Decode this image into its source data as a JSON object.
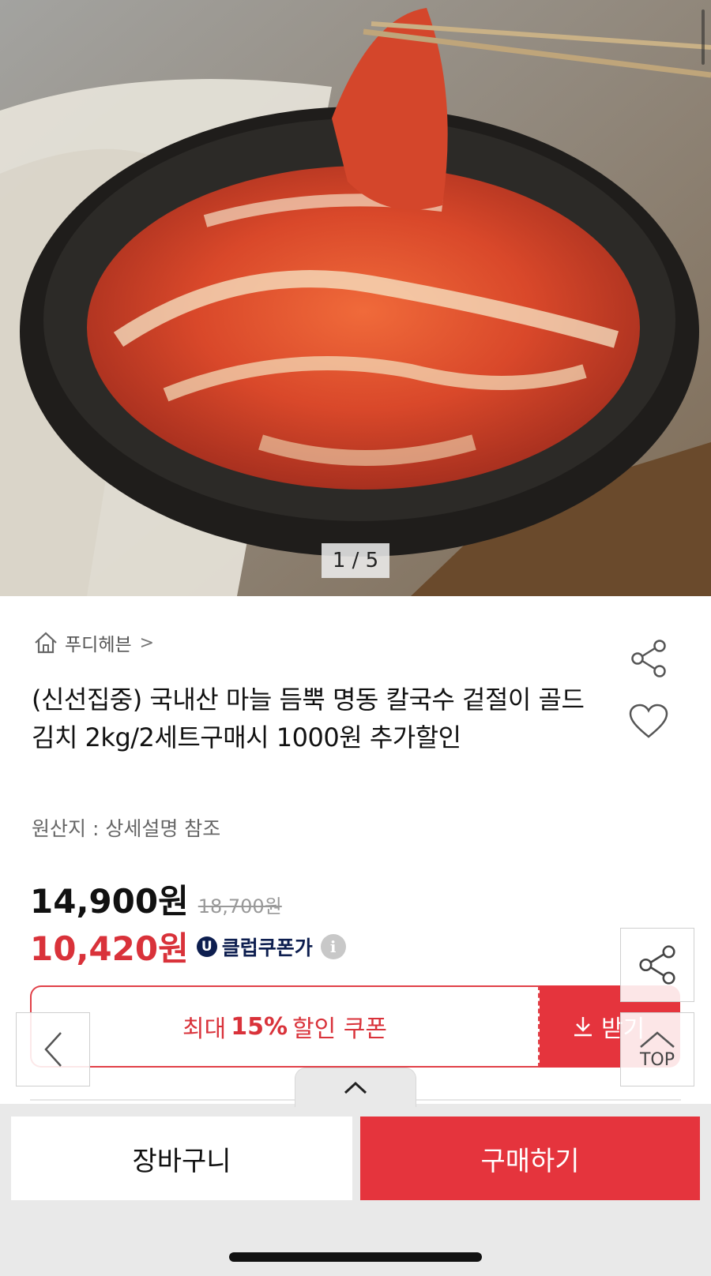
{
  "gallery": {
    "counter": "1 / 5"
  },
  "store": {
    "name": "푸디헤븐",
    "chevron": ">"
  },
  "product": {
    "title": "(신선집중) 국내산 마늘 듬뿍 명동 칼국수 겉절이 골드 김치 2kg/2세트구매시 1000원 추가할인",
    "origin": "원산지 : 상세설명 참조"
  },
  "pricing": {
    "price": "14,900원",
    "original_price": "18,700원",
    "coupon_price": "10,420원",
    "club_badge": "U",
    "club_label": "클럽쿠폰가",
    "info_icon": "i"
  },
  "coupon": {
    "prefix": "최대",
    "percent": "15%",
    "suffix": "할인 쿠폰",
    "receive_label": "받기"
  },
  "floating": {
    "top_label": "TOP"
  },
  "bottom": {
    "cart_label": "장바구니",
    "buy_label": "구매하기"
  },
  "colors": {
    "accent": "#e5343d",
    "club_navy": "#0d1e4f"
  },
  "icons": [
    "home-icon",
    "share-icon",
    "heart-icon",
    "info-icon",
    "download-icon",
    "chevron-left-icon",
    "chevron-up-icon"
  ]
}
